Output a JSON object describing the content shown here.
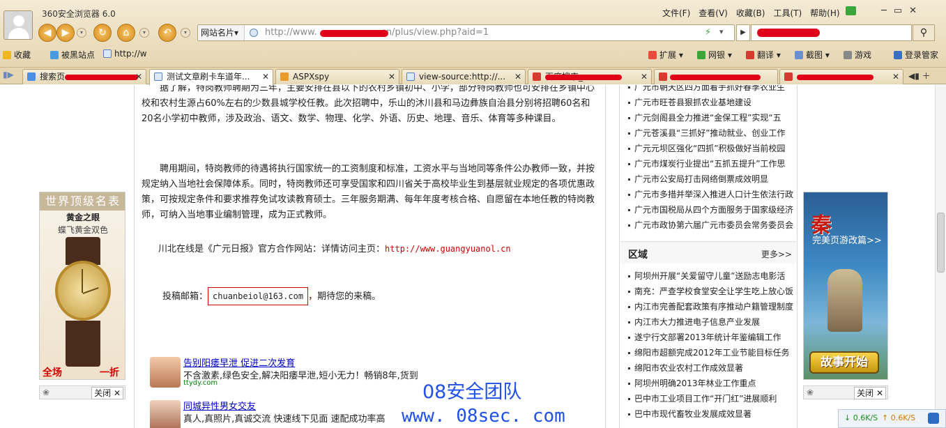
{
  "browser": {
    "app_title": "360安全浏览器 6.0",
    "menu": [
      "文件(F)",
      "查看(V)",
      "收藏(B)",
      "工具(T)",
      "帮助(H)"
    ],
    "window_controls": [
      "─",
      "▭",
      "✕"
    ],
    "address": {
      "site_label": "网站名片▾",
      "url": "http://www.",
      "url_tail": "cn/plus/view.php?aid=1"
    },
    "favorites": {
      "fav_label": "收藏",
      "item1": "被黑站点",
      "item2": "http://w"
    },
    "tools": {
      "extend": "扩展",
      "netbank": "网银",
      "translate": "翻译",
      "screenshot": "截图",
      "games": "游戏",
      "login": "登录管家"
    },
    "tabs": [
      {
        "label": "搜索页"
      },
      {
        "label": "测试文章刷卡车道年..."
      },
      {
        "label": "ASPXspy"
      },
      {
        "label": "view-source:http://..."
      },
      {
        "label": "百度搜索_"
      },
      {
        "label": ""
      },
      {
        "label": ""
      }
    ]
  },
  "article": {
    "para1": "据了解，特岗教师聘期为三年，主要安排在县以下的农村乡镇初中、小学，部分特岗教师也可安排在乡镇中心校和农村生源占60%左右的少数县城学校任教。此次招聘中，乐山的沐川县和马边彝族自治县分别将招聘60名和20名小学初中教师，涉及政治、语文、数学、物理、化学、外语、历史、地理、音乐、体育等多种课目。",
    "para2": "聘用期间，特岗教师的待遇将执行国家统一的工资制度和标准，工资水平与当地同等条件公办教师一致，并按规定纳入当地社会保障体系。同时，特岗教师还可享受国家和四川省关于高校毕业生到基层就业规定的各项优惠政策，可按规定条件和要求推荐免试攻读教育硕士。三年服务期满、每年年度考核合格、自愿留在本地任教的特岗教师，可纳入当地事业编制管理，成为正式教师。",
    "para3_text": "川北在线是《广元日报》官方合作网站：详情访问主页：",
    "para3_link": "http://www.guangyuanol.cn",
    "para4_text": "投稿邮箱：",
    "para4_email": "chuanbeiol@163.com",
    "para4_tail": "，期待您的来稿。"
  },
  "ads": {
    "ad1": {
      "title": "告别阳痿早泄 促进二次发育",
      "desc": "不含激素,绿色安全,解决阳痿早泄,短小无力！畅销8年,货到",
      "domain": "ttydy.com"
    },
    "ad2": {
      "title": "同城异性男女交友",
      "desc": "真人,真照片,真诚交流 快速线下见面 速配成功率高"
    },
    "watch": {
      "top": "世界顶级名表",
      "line1": "黄金之眼",
      "line2": "蝶飞黄金双色",
      "tag_left": "全场",
      "tag_right": "一折"
    },
    "game": {
      "logo": "秦",
      "sub": "完美页游改篇>>",
      "button": "故事开始"
    },
    "close_label": "关闭 ✕",
    "paw": "❀"
  },
  "watermark": {
    "team": "08安全团队",
    "site": "www. 08sec. com"
  },
  "sidebar": {
    "news_top": [
      "广元市朝天区四方面着手抓好春季农业生",
      "广元市旺苍县狠抓农业基地建设",
      "广元剑阁县全力推进“金保工程”实现“五",
      "广元苍溪县“三抓好”推动就业、创业工作",
      "广元元坝区强化“四抓”积极做好当前校园",
      "广元市煤炭行业提出“五抓五提升”工作思",
      "广元市公安局打击网络倒票成效明显",
      "广元市多措并举深入推进人口计生依法行政",
      "广元市国税局从四个方面服务于国家级经济",
      "广元市政协第六届广元市委员会常务委员会"
    ],
    "region_title": "区域",
    "region_more": "更多>>",
    "news_region": [
      "阿坝州开展“关爱留守儿童”送励志电影活",
      "南充：严查学校食堂安全让学生吃上放心饭",
      "内江市完善配套政策有序推动户籍管理制度",
      "内江市大力推进电子信息产业发展",
      "遂宁行文部署2013年统计年鉴编辑工作",
      "绵阳市超额完成2012年工业节能目标任务",
      "绵阳市农业农村工作成效显著",
      "阿坝州明确2013年林业工作重点",
      "巴中市工业项目工作“开门红”进展顺利",
      "巴中市现代畜牧业发展成效显著"
    ]
  },
  "status": {
    "down": "0.6K/S",
    "up": "0.6K/S"
  }
}
